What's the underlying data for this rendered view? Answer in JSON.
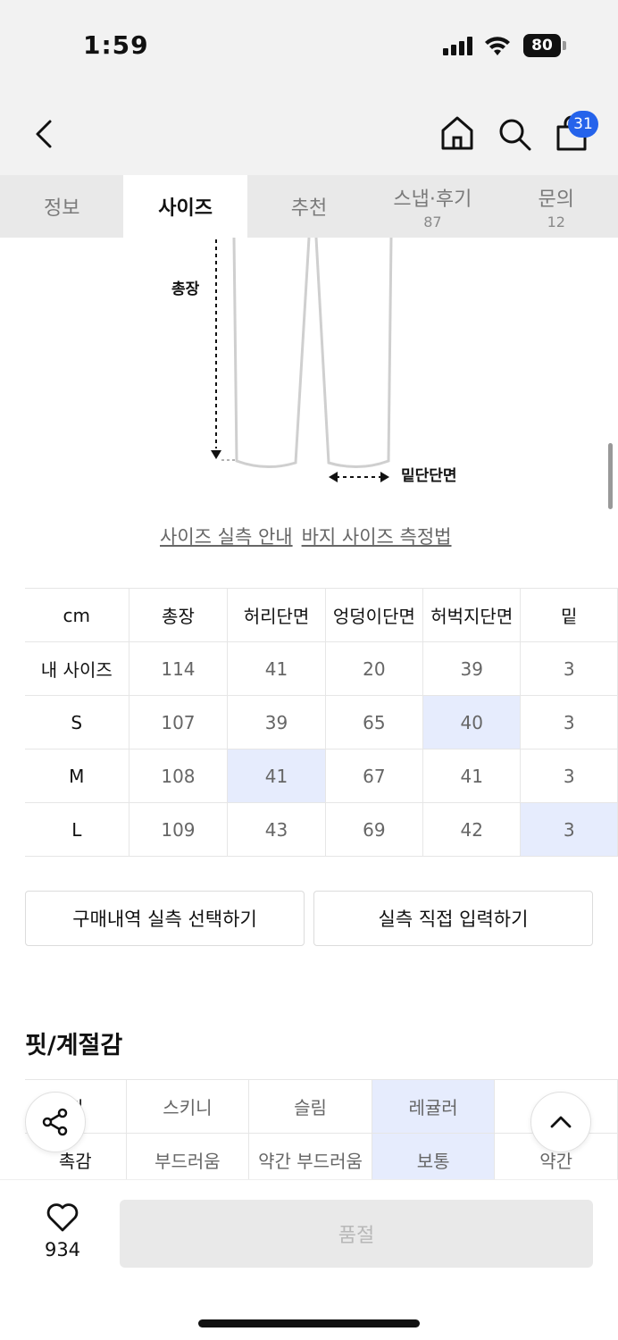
{
  "status_bar": {
    "time": "1:59",
    "battery": "80"
  },
  "nav": {
    "cart_count": "31"
  },
  "tabs": [
    {
      "label": "정보",
      "count": ""
    },
    {
      "label": "사이즈",
      "count": ""
    },
    {
      "label": "추천",
      "count": ""
    },
    {
      "label": "스냅·후기",
      "count": "87"
    },
    {
      "label": "문의",
      "count": "12"
    }
  ],
  "diagram": {
    "total_length_label": "총장",
    "hem_label": "밑단단면"
  },
  "guide_links": {
    "actual_size_guide": "사이즈 실측 안내",
    "pants_measure_guide": "바지 사이즈 측정법"
  },
  "size_table": {
    "headers": [
      "cm",
      "총장",
      "허리단면",
      "엉덩이단면",
      "허벅지단면",
      "밑"
    ],
    "rows": [
      {
        "label": "내 사이즈",
        "values": [
          "114",
          "41",
          "20",
          "39",
          "3"
        ]
      },
      {
        "label": "S",
        "values": [
          "107",
          "39",
          "65",
          "40",
          "3"
        ]
      },
      {
        "label": "M",
        "values": [
          "108",
          "41",
          "67",
          "41",
          "3"
        ]
      },
      {
        "label": "L",
        "values": [
          "109",
          "43",
          "69",
          "42",
          "3"
        ]
      }
    ]
  },
  "buttons": {
    "select_purchase": "구매내역 실측 선택하기",
    "manual_input": "실측 직접 입력하기"
  },
  "fit_section": {
    "title": "핏/계절감",
    "rows": [
      {
        "label": "핏",
        "values": [
          "스키니",
          "슬림",
          "레귤러",
          "루"
        ]
      },
      {
        "label": "촉감",
        "values": [
          "부드러움",
          "약간 부드러움",
          "보통",
          "약간"
        ]
      }
    ]
  },
  "bottom": {
    "like_count": "934",
    "soldout_label": "품절"
  },
  "colors": {
    "accent": "#2563eb",
    "highlight": "#e6ecfd"
  }
}
